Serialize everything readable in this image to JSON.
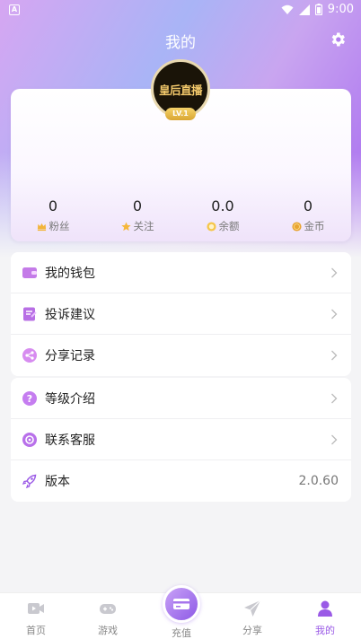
{
  "status_bar": {
    "app_glyph": "A",
    "time": "9:00"
  },
  "header": {
    "title": "我的"
  },
  "profile": {
    "avatar_text": "皇后直播",
    "level": "LV.1"
  },
  "stats": [
    {
      "value": "0",
      "label": "粉丝",
      "icon": "crown-icon"
    },
    {
      "value": "0",
      "label": "关注",
      "icon": "star-icon"
    },
    {
      "value": "0.0",
      "label": "余额",
      "icon": "balance-icon"
    },
    {
      "value": "0",
      "label": "金币",
      "icon": "coin-icon"
    }
  ],
  "menu_group_1": [
    {
      "label": "我的钱包",
      "icon": "wallet-icon"
    },
    {
      "label": "投诉建议",
      "icon": "feedback-icon"
    },
    {
      "label": "分享记录",
      "icon": "share-record-icon"
    }
  ],
  "menu_group_2": [
    {
      "label": "等级介绍",
      "icon": "question-icon"
    },
    {
      "label": "联系客服",
      "icon": "customer-service-icon"
    },
    {
      "label": "版本",
      "icon": "rocket-icon",
      "value": "2.0.60"
    }
  ],
  "tabbar": [
    {
      "label": "首页",
      "icon": "video-icon"
    },
    {
      "label": "游戏",
      "icon": "gamepad-icon"
    },
    {
      "label": "充值",
      "icon": "card-icon"
    },
    {
      "label": "分享",
      "icon": "send-icon"
    },
    {
      "label": "我的",
      "icon": "person-icon",
      "active": true
    }
  ],
  "colors": {
    "accent": "#9a5ae6",
    "gold": "#f3c96b"
  }
}
